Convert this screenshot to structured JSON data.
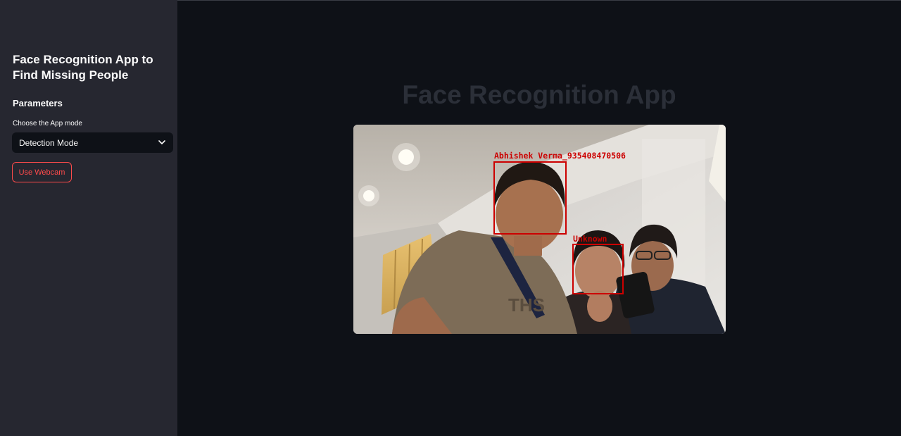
{
  "sidebar": {
    "title": "Face Recognition App to Find Missing People",
    "section_header": "Parameters",
    "mode_select": {
      "label": "Choose the App mode",
      "value": "Detection Mode"
    },
    "webcam_button_label": "Use Webcam"
  },
  "main": {
    "title": "Face Recognition App",
    "video": {
      "detections": [
        {
          "label": "Abhishek Verma_935408470506"
        },
        {
          "label": "Unknown"
        }
      ]
    }
  },
  "colors": {
    "sidebar_bg": "#262730",
    "main_bg": "#0e1117",
    "accent": "#ff4b4b",
    "detection_box": "#cc0000"
  }
}
